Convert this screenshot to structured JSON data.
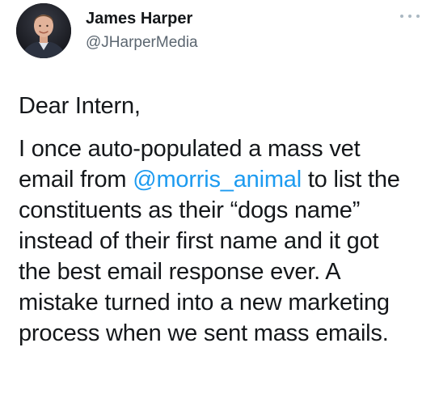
{
  "author": {
    "name": "James Harper",
    "handle": "@JHarperMedia",
    "avatar_icon": "profile-photo"
  },
  "menu": {
    "icon": "more-dots-icon"
  },
  "tweet": {
    "greeting": "Dear Intern,",
    "lines": [
      {
        "pre": "I once auto-populated a mass vet"
      },
      {
        "pre": "email from ",
        "mention": "@morris_animal",
        "post": " to list the"
      },
      {
        "pre": "constituents as their “dogs name”"
      },
      {
        "pre": "instead of their first name and it got"
      },
      {
        "pre": "the best email response ever. A"
      },
      {
        "pre": "mistake turned into a new marketing"
      },
      {
        "pre": "process when we sent mass emails."
      }
    ]
  },
  "colors": {
    "mention": "#1d9bf0",
    "handle": "#5b6670",
    "text": "#14171a"
  }
}
